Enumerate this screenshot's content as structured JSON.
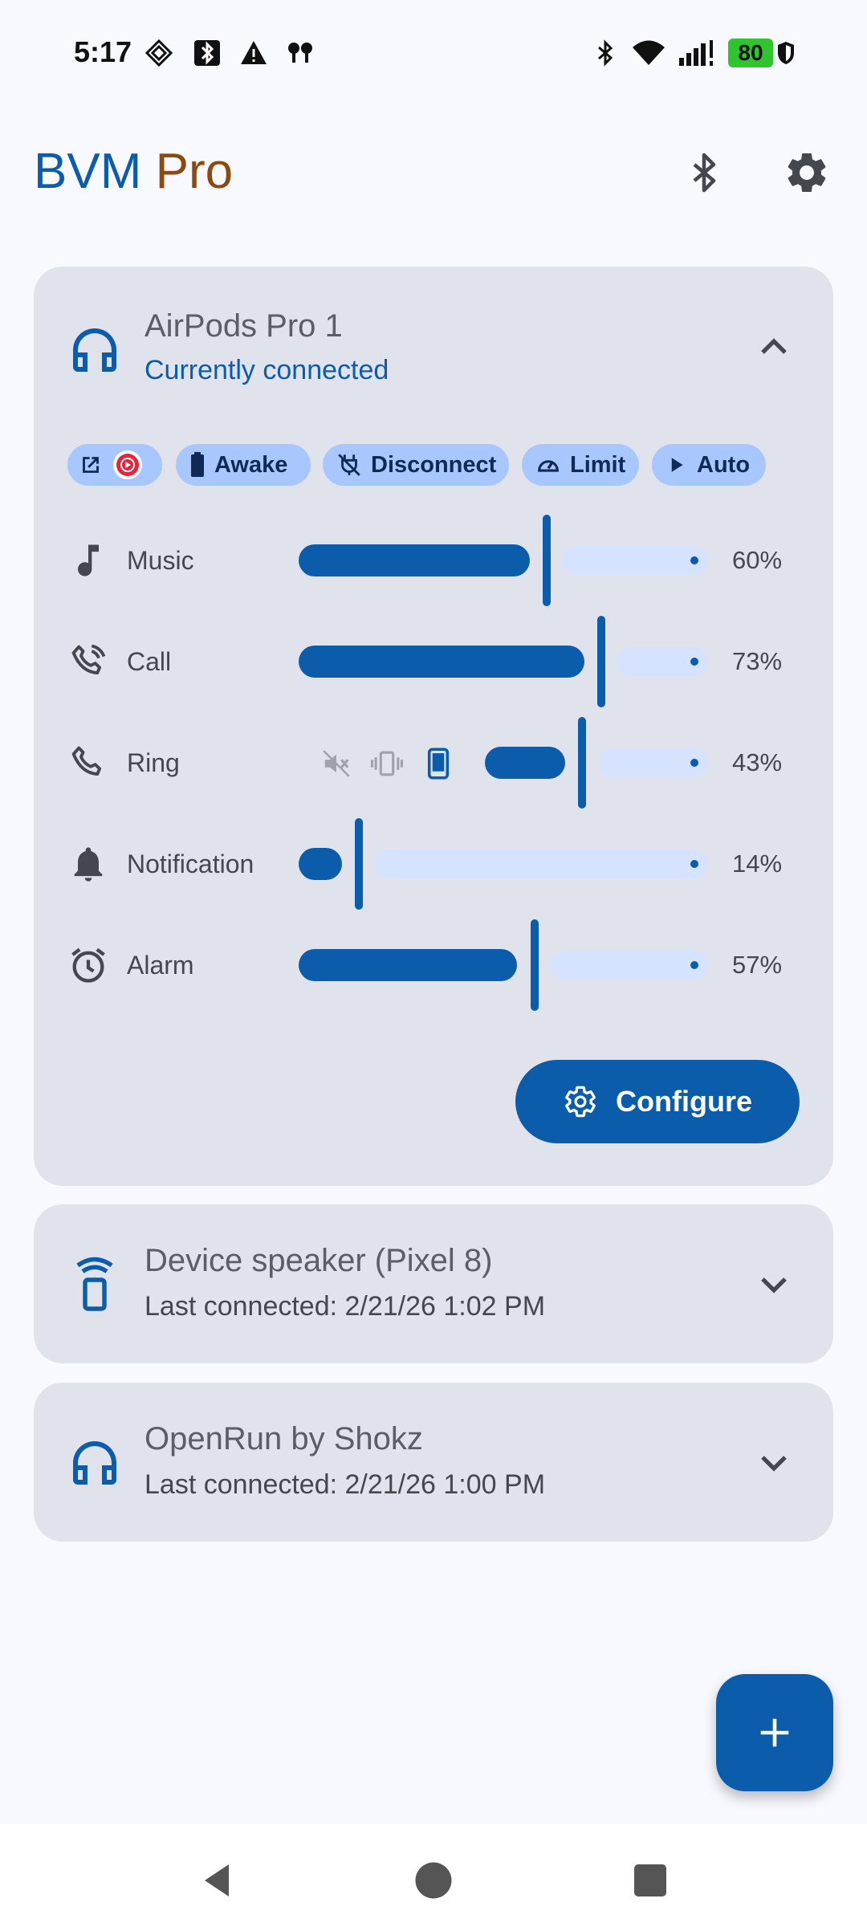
{
  "status_bar": {
    "time": "5:17",
    "battery": "80",
    "icons": [
      "notification-icon",
      "bluetooth-box-icon",
      "warning-icon",
      "earbuds-icon",
      "bluetooth-icon",
      "wifi-icon",
      "signal-icon",
      "battery-icon",
      "shield-icon"
    ]
  },
  "app": {
    "title_part1": "BVM",
    "title_part2": "Pro",
    "accent": "#0b5cab",
    "brand2": "#8a4b10"
  },
  "cards": [
    {
      "name": "AirPods Pro 1",
      "subtitle": "Currently connected",
      "expanded": true,
      "chips": [
        {
          "label": "",
          "icon": "launch-app-icon"
        },
        {
          "label": "Awake",
          "icon": "battery-icon"
        },
        {
          "label": "Disconnect",
          "icon": "plug-off-icon"
        },
        {
          "label": "Limit",
          "icon": "speedometer-icon"
        },
        {
          "label": "Auto",
          "icon": "play-icon"
        }
      ],
      "volumes": [
        {
          "label": "Music",
          "value": 60,
          "pct": "60%",
          "icon": "music-note-icon"
        },
        {
          "label": "Call",
          "value": 73,
          "pct": "73%",
          "icon": "phone-call-icon"
        },
        {
          "label": "Ring",
          "value": 43,
          "pct": "43%",
          "icon": "phone-icon",
          "ring_modes": [
            "sound-off-icon",
            "vibrate-icon",
            "ring-phone-icon"
          ]
        },
        {
          "label": "Notification",
          "value": 14,
          "pct": "14%",
          "icon": "bell-icon"
        },
        {
          "label": "Alarm",
          "value": 57,
          "pct": "57%",
          "icon": "alarm-icon"
        }
      ],
      "configure_label": "Configure"
    },
    {
      "name": "Device speaker (Pixel 8)",
      "subtitle": "Last connected: 2/21/26 1:02 PM",
      "expanded": false,
      "icon": "phone-speaker-icon"
    },
    {
      "name": "OpenRun by Shokz",
      "subtitle": "Last connected: 2/21/26 1:00 PM",
      "expanded": false,
      "icon": "headphones-icon"
    }
  ],
  "fab": {
    "icon": "plus-icon"
  },
  "nav": {
    "icons": [
      "back-icon",
      "home-icon",
      "recents-icon"
    ]
  }
}
